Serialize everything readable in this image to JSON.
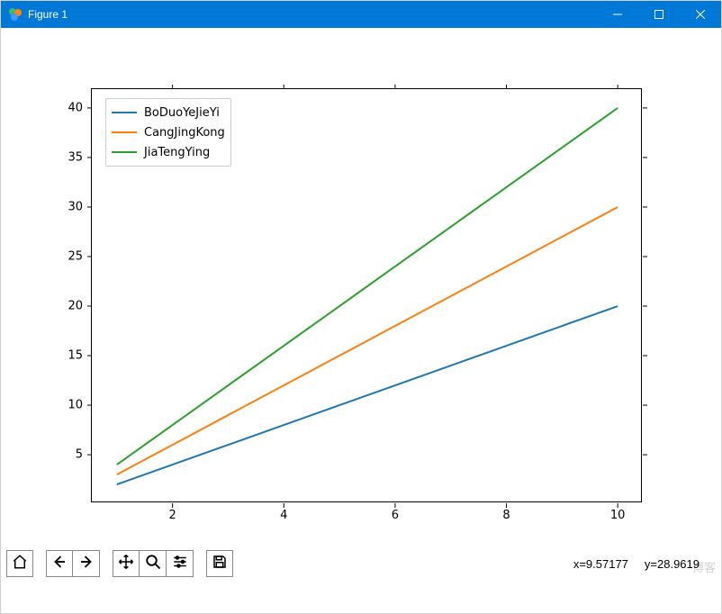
{
  "window": {
    "title": "Figure 1",
    "buttons": {
      "min": "minimize",
      "max": "maximize",
      "close": "close"
    }
  },
  "chart_data": {
    "type": "line",
    "x": [
      1,
      2,
      3,
      4,
      5,
      6,
      7,
      8,
      9,
      10
    ],
    "series": [
      {
        "name": "BoDuoYeJieYi",
        "color": "#1f77b4",
        "values": [
          2,
          4,
          6,
          8,
          10,
          12,
          14,
          16,
          18,
          20
        ]
      },
      {
        "name": "CangJingKong",
        "color": "#ff7f0e",
        "values": [
          3,
          6,
          9,
          12,
          15,
          18,
          21,
          24,
          27,
          30
        ]
      },
      {
        "name": "JiaTengYing",
        "color": "#2ca02c",
        "values": [
          4,
          8,
          12,
          16,
          20,
          24,
          28,
          32,
          36,
          40
        ]
      }
    ],
    "xticks": [
      2,
      4,
      6,
      8,
      10
    ],
    "yticks": [
      5,
      10,
      15,
      20,
      25,
      30,
      35,
      40
    ],
    "xlim": [
      0.55,
      10.45
    ],
    "ylim": [
      0.1,
      41.9
    ],
    "title": "",
    "xlabel": "",
    "ylabel": "",
    "legend_loc": "upper left"
  },
  "toolbar": {
    "home": "Home",
    "back": "Back",
    "forward": "Forward",
    "pan": "Pan",
    "zoom": "Zoom",
    "config": "Configure subplots",
    "save": "Save"
  },
  "status": {
    "x_label": "x=",
    "x_val": "9.57177",
    "y_label": "y=",
    "y_val": "28.9619"
  },
  "watermark": "博客"
}
